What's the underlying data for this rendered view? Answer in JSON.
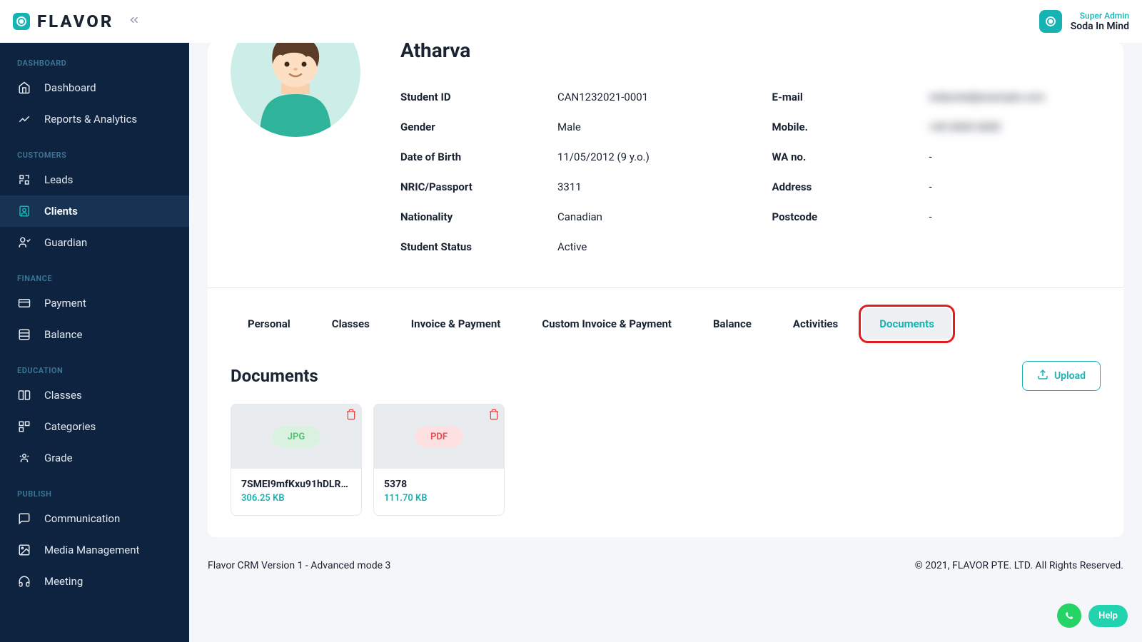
{
  "header": {
    "logo_text": "FLAVOR",
    "user_role": "Super Admin",
    "user_name": "Soda In Mind"
  },
  "sidebar": {
    "sections": {
      "dashboard_label": "DASHBOARD",
      "customers_label": "CUSTOMERS",
      "finance_label": "FINANCE",
      "education_label": "EDUCATION",
      "publish_label": "PUBLISH"
    },
    "items": {
      "dashboard": "Dashboard",
      "reports": "Reports & Analytics",
      "leads": "Leads",
      "clients": "Clients",
      "guardian": "Guardian",
      "payment": "Payment",
      "balance": "Balance",
      "classes": "Classes",
      "categories": "Categories",
      "grade": "Grade",
      "communication": "Communication",
      "media": "Media Management",
      "meeting": "Meeting"
    }
  },
  "profile": {
    "name": "Atharva",
    "student_id_label": "Student ID",
    "student_id": "CAN1232021-0001",
    "gender_label": "Gender",
    "gender": "Male",
    "dob_label": "Date of Birth",
    "dob": "11/05/2012 (9 y.o.)",
    "nric_label": "NRIC/Passport",
    "nric": "3311",
    "nationality_label": "Nationality",
    "nationality": "Canadian",
    "status_label": "Student Status",
    "status": "Active",
    "email_label": "E-mail",
    "email": "redacted@example.com",
    "mobile_label": "Mobile.",
    "mobile": "+00 0000 0000",
    "wa_label": "WA no.",
    "wa": "-",
    "address_label": "Address",
    "address": "-",
    "postcode_label": "Postcode",
    "postcode": "-"
  },
  "tabs": {
    "personal": "Personal",
    "classes": "Classes",
    "invoice": "Invoice & Payment",
    "custom_invoice": "Custom Invoice & Payment",
    "balance": "Balance",
    "activities": "Activities",
    "documents": "Documents"
  },
  "docs": {
    "title": "Documents",
    "upload_label": "Upload",
    "items": [
      {
        "badge": "JPG",
        "name": "7SMEI9mfKxu91hDLR…",
        "size": "306.25 KB"
      },
      {
        "badge": "PDF",
        "name": "5378",
        "size": "111.70 KB"
      }
    ]
  },
  "footer": {
    "version": "Flavor CRM Version 1 - Advanced mode 3",
    "copyright": "© 2021, FLAVOR PTE. LTD. All Rights Reserved."
  },
  "help": {
    "label": "Help"
  }
}
